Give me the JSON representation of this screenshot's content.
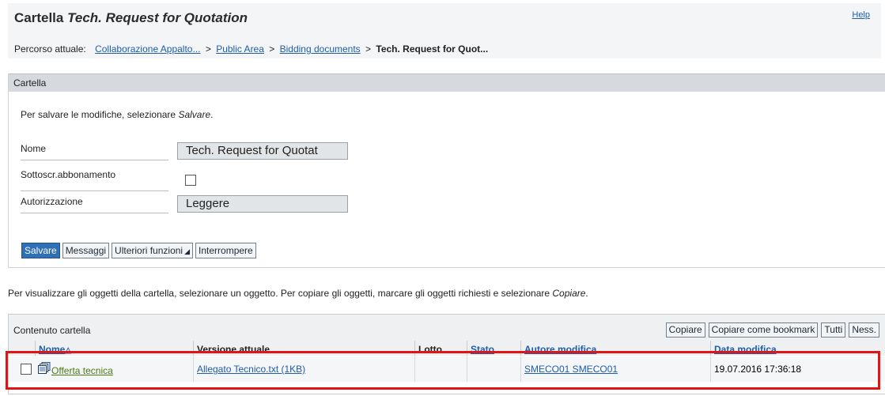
{
  "header": {
    "title_prefix": "Cartella",
    "title_object": "Tech. Request for Quotation",
    "help": "Help"
  },
  "breadcrumb": {
    "label": "Percorso attuale:",
    "items": [
      {
        "label": "Collaborazione Appalto..."
      },
      {
        "label": "Public Area"
      },
      {
        "label": "Bidding documents"
      }
    ],
    "separator": ">",
    "current": "Tech. Request for Quot..."
  },
  "panel": {
    "title": "Cartella",
    "hint_prefix": "Per salvare le modifiche, selezionare",
    "hint_action": "Salvare",
    "hint_suffix": ".",
    "fields": {
      "name_label": "Nome",
      "name_value": "Tech. Request for Quotat",
      "subscription_label": "Sottoscr.abbonamento",
      "subscription_checked": false,
      "authorization_label": "Autorizzazione",
      "authorization_value": "Leggere"
    },
    "buttons": {
      "save": "Salvare",
      "messages": "Messaggi",
      "more_functions": "Ulteriori funzioni",
      "cancel": "Interrompere"
    }
  },
  "objects_hint": {
    "text": "Per visualizzare gli oggetti della cartella, selezionare un oggetto. Per copiare gli oggetti, marcare gli oggetti richiesti e selezionare",
    "action": "Copiare",
    "suffix": "."
  },
  "contents": {
    "title": "Contenuto cartella",
    "actions": {
      "copy": "Copiare",
      "copy_bookmark": "Copiare come bookmark",
      "all": "Tutti",
      "none": "Ness."
    },
    "columns": {
      "name": "Nome",
      "name_sort_glyph": "△",
      "current_version": "Versione attuale",
      "lot": "Lotto",
      "status": "Stato",
      "modified_by": "Autore modifica",
      "modified_date": "Data modifica"
    },
    "rows": [
      {
        "name": "Offerta tecnica",
        "current_version": "Allegato Tecnico.txt (1KB)",
        "lot": "",
        "status": "",
        "modified_by": "SMECO01 SMECO01",
        "modified_date": "19.07.2016 17:36:18",
        "icon": "document-folder-icon"
      }
    ]
  },
  "colors": {
    "link": "#1f5da8",
    "primary_button": "#2f6fb5",
    "highlight": "#e01515",
    "name_link": "#4a7a13"
  }
}
